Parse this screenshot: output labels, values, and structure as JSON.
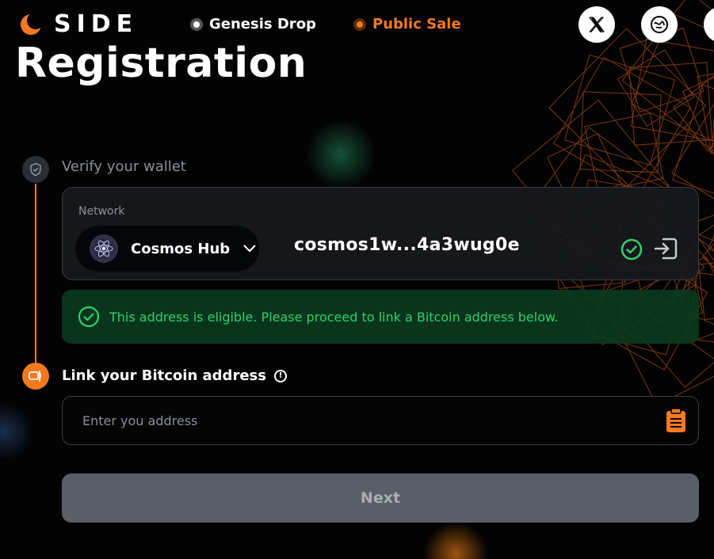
{
  "brand": {
    "name": "SIDE",
    "logo_icon": "side-logo-icon"
  },
  "nav": {
    "phases": [
      {
        "label": "Genesis Drop",
        "state": "inactive"
      },
      {
        "label": "Public Sale",
        "state": "active"
      }
    ],
    "social": [
      {
        "icon": "x-twitter-icon"
      },
      {
        "icon": "discord-icon"
      }
    ]
  },
  "page": {
    "title": "Registration"
  },
  "steps": {
    "verify": {
      "label": "Verify your wallet",
      "icon": "shield-check-icon",
      "network_label": "Network",
      "network_name": "Cosmos Hub",
      "network_icon": "cosmos-atom-icon",
      "address": "cosmos1w...4a3wug0e",
      "eligible_message": "This address is eligible. Please proceed to link a Bitcoin address below."
    },
    "link": {
      "label": "Link your Bitcoin address",
      "icon": "wallet-link-icon",
      "input_placeholder": "Enter you address",
      "input_value": "",
      "paste_icon": "clipboard-icon"
    }
  },
  "actions": {
    "next_label": "Next"
  },
  "colors": {
    "accent": "#f47a20",
    "success": "#2fd16c",
    "success_bg": "#0a3a1e",
    "button_disabled": "#5a5e66"
  }
}
